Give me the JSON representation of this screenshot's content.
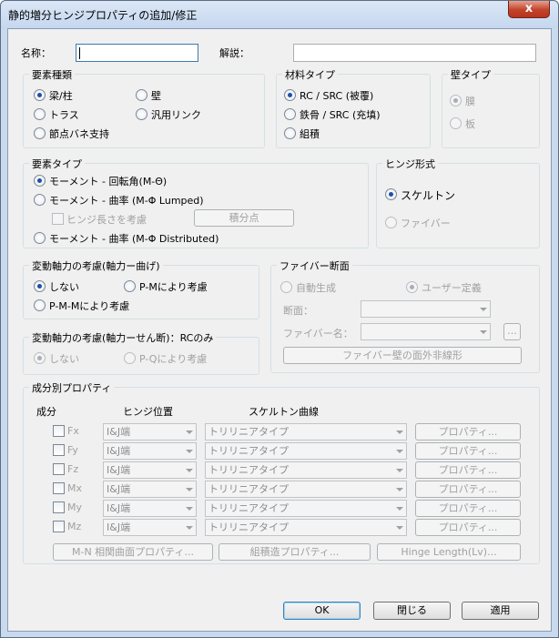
{
  "window": {
    "title": "静的増分ヒンジプロパティの追加/修正",
    "close_label": "x"
  },
  "name_row": {
    "name_label": "名称：",
    "name_value": "",
    "desc_label": "解説：",
    "desc_value": ""
  },
  "element_kind": {
    "title": "要素種類",
    "options": [
      "梁/柱",
      "壁",
      "トラス",
      "汎用リンク",
      "節点バネ支持"
    ],
    "selected": "梁/柱"
  },
  "material_type": {
    "title": "材料タイプ",
    "options": [
      "RC / SRC (被覆)",
      "鉄骨 / SRC (充填)",
      "組積"
    ],
    "selected": "RC / SRC (被覆)"
  },
  "wall_type": {
    "title": "壁タイプ",
    "options": [
      "膜",
      "板"
    ],
    "selected": "膜"
  },
  "element_type": {
    "title": "要素タイプ",
    "opt1": "モーメント - 回転角(M-Θ)",
    "opt2": "モーメント - 曲率 (M-Φ Lumped)",
    "hinge_length_check": "ヒンジ長さを考慮",
    "integration_button": "積分点",
    "opt3": "モーメント - 曲率 (M-Φ Distributed)",
    "selected": "モーメント - 回転角(M-Θ)"
  },
  "hinge_form": {
    "title": "ヒンジ形式",
    "options": [
      "スケルトン",
      "ファイバー"
    ],
    "selected": "スケルトン"
  },
  "axial_bending": {
    "title": "変動軸力の考慮(軸力ー曲げ)",
    "options": [
      "しない",
      "P-Mにより考慮",
      "P-M-Mにより考慮"
    ],
    "selected": "しない"
  },
  "axial_shear": {
    "title": "変動軸力の考慮(軸力ーせん断)：RCのみ",
    "options": [
      "しない",
      "P-Qにより考慮"
    ],
    "selected": "しない"
  },
  "fiber_section": {
    "title": "ファイバー断面",
    "auto_label": "自動生成",
    "user_label": "ユーザー定義",
    "section_label": "断面：",
    "fiber_name_label": "ファイバー名：",
    "ellipsis_button": "...",
    "wall_button": "ファイバー壁の面外非線形"
  },
  "components": {
    "title": "成分別プロパティ",
    "col_component": "成分",
    "col_hinge_pos": "ヒンジ位置",
    "col_skeleton": "スケルトン曲線",
    "property_button": "プロパティ...",
    "rows": [
      {
        "name": "Fx",
        "pos": "I&J端",
        "curve": "トリリニアタイプ"
      },
      {
        "name": "Fy",
        "pos": "I&J端",
        "curve": "トリリニアタイプ"
      },
      {
        "name": "Fz",
        "pos": "I&J端",
        "curve": "トリリニアタイプ"
      },
      {
        "name": "Mx",
        "pos": "I&J端",
        "curve": "トリリニアタイプ"
      },
      {
        "name": "My",
        "pos": "I&J端",
        "curve": "トリリニアタイプ"
      },
      {
        "name": "Mz",
        "pos": "I&J端",
        "curve": "トリリニアタイプ"
      }
    ],
    "mn_button": "M-N 相関曲面プロパティ...",
    "masonry_button": "組積造プロパティ...",
    "hinge_length_button": "Hinge Length(Lv)..."
  },
  "footer": {
    "ok": "OK",
    "close": "閉じる",
    "apply": "適用"
  }
}
